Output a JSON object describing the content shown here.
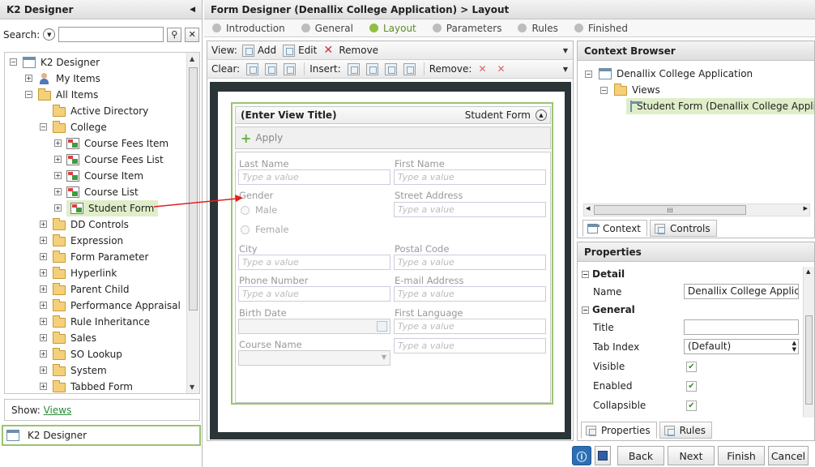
{
  "left": {
    "title": "K2 Designer",
    "search_label": "Search:",
    "search_value": "",
    "tree": [
      {
        "label": "K2 Designer",
        "depth": 0,
        "icon": "k2"
      },
      {
        "label": "My Items",
        "depth": 1,
        "icon": "user"
      },
      {
        "label": "All Items",
        "depth": 1,
        "icon": "folder-open"
      },
      {
        "label": "Active Directory",
        "depth": 2,
        "icon": "folder"
      },
      {
        "label": "College",
        "depth": 2,
        "icon": "folder-open"
      },
      {
        "label": "Course Fees Item",
        "depth": 3,
        "icon": "form"
      },
      {
        "label": "Course Fees List",
        "depth": 3,
        "icon": "form"
      },
      {
        "label": "Course Item",
        "depth": 3,
        "icon": "form"
      },
      {
        "label": "Course List",
        "depth": 3,
        "icon": "form"
      },
      {
        "label": "Student Form",
        "depth": 3,
        "icon": "form",
        "selected": true
      },
      {
        "label": "DD Controls",
        "depth": 2,
        "icon": "folder"
      },
      {
        "label": "Expression",
        "depth": 2,
        "icon": "folder"
      },
      {
        "label": "Form Parameter",
        "depth": 2,
        "icon": "folder"
      },
      {
        "label": "Hyperlink",
        "depth": 2,
        "icon": "folder"
      },
      {
        "label": "Parent Child",
        "depth": 2,
        "icon": "folder"
      },
      {
        "label": "Performance Appraisal",
        "depth": 2,
        "icon": "folder"
      },
      {
        "label": "Rule Inheritance",
        "depth": 2,
        "icon": "folder"
      },
      {
        "label": "Sales",
        "depth": 2,
        "icon": "folder"
      },
      {
        "label": "SO Lookup",
        "depth": 2,
        "icon": "folder"
      },
      {
        "label": "System",
        "depth": 2,
        "icon": "folder"
      },
      {
        "label": "Tabbed Form",
        "depth": 2,
        "icon": "folder"
      }
    ],
    "show_label": "Show:",
    "show_link": "Views",
    "footer": "K2 Designer"
  },
  "main": {
    "title": "Form Designer (Denallix College Application) > Layout",
    "steps": [
      {
        "label": "Introduction",
        "active": false
      },
      {
        "label": "General",
        "active": false
      },
      {
        "label": "Layout",
        "active": true
      },
      {
        "label": "Parameters",
        "active": false
      },
      {
        "label": "Rules",
        "active": false
      },
      {
        "label": "Finished",
        "active": false
      }
    ],
    "toolbar": {
      "view_label": "View:",
      "add": "Add",
      "edit": "Edit",
      "remove": "Remove",
      "clear_label": "Clear:",
      "insert_label": "Insert:",
      "remove_label": "Remove:"
    },
    "view": {
      "title": "(Enter View Title)",
      "name": "Student Form",
      "apply": "Apply",
      "placeholder": "Type a value",
      "fields": {
        "last_name": "Last Name",
        "first_name": "First Name",
        "gender": "Gender",
        "male": "Male",
        "female": "Female",
        "street": "Street Address",
        "city": "City",
        "postal": "Postal Code",
        "phone": "Phone Number",
        "email": "E-mail Address",
        "birth": "Birth Date",
        "language": "First Language",
        "course": "Course Name"
      }
    }
  },
  "context": {
    "title": "Context Browser",
    "app": "Denallix College Application",
    "views": "Views",
    "item": "Student Form (Denallix College Appli",
    "tab_context": "Context",
    "tab_controls": "Controls"
  },
  "properties": {
    "title": "Properties",
    "detail": "Detail",
    "name_label": "Name",
    "name_value": "Denallix College Applicat",
    "general": "General",
    "title_label": "Title",
    "title_value": "",
    "tabindex_label": "Tab Index",
    "tabindex_value": "(Default)",
    "visible_label": "Visible",
    "enabled_label": "Enabled",
    "collapsible_label": "Collapsible",
    "tab_properties": "Properties",
    "tab_rules": "Rules"
  },
  "buttons": {
    "back": "Back",
    "next": "Next",
    "finish": "Finish",
    "cancel": "Cancel"
  },
  "colors": {
    "accent": "#9bc36f",
    "selected": "#dfeec9",
    "arrow": "#e02020",
    "link": "#2a8a3a"
  }
}
